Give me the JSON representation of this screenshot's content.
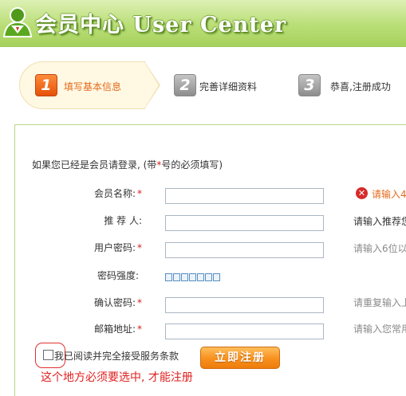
{
  "header": {
    "title": "会员中心 User Center"
  },
  "steps": [
    {
      "num": "1",
      "label": "填写基本信息"
    },
    {
      "num": "2",
      "label": "完善详细资料"
    },
    {
      "num": "3",
      "label": "恭喜,注册成功"
    }
  ],
  "form": {
    "intro_before": "如果您已经是会员请登录, (带",
    "intro_star": "*",
    "intro_after": "号的必须填写)",
    "required_mark": "*",
    "fields": {
      "member_name": {
        "label": "会员名称:",
        "hint": "请输入4"
      },
      "referrer": {
        "label": "推 荐 人:",
        "hint": "请输入推荐您"
      },
      "password": {
        "label": "用户密码:",
        "hint": "请输入6位以"
      },
      "strength": {
        "label": "密码强度:"
      },
      "confirm": {
        "label": "确认密码:",
        "hint": "请重复输入上"
      },
      "email": {
        "label": "邮箱地址:",
        "hint": "请输入您常用"
      }
    },
    "agree_text": "我已阅读并完全接受服务条款",
    "submit_label": "立即注册",
    "annotation": "这个地方必须要选中, 才能注册"
  },
  "colors": {
    "accent": "#e46a1c",
    "required": "#d21e1e",
    "banner": "#b9de76"
  }
}
